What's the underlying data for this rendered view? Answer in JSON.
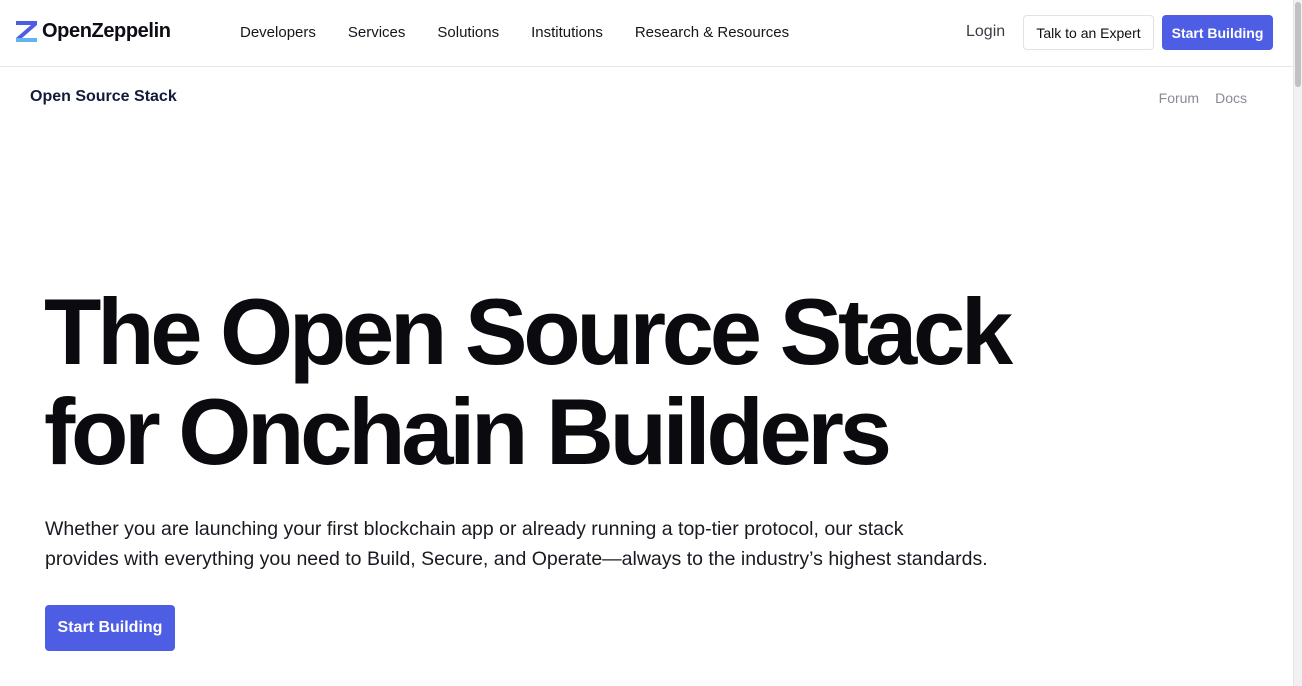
{
  "header": {
    "logo": {
      "icon": "openzeppelin-z-icon",
      "text": "OpenZeppelin",
      "color": "#4e5ee4"
    },
    "nav": [
      {
        "label": "Developers"
      },
      {
        "label": "Services"
      },
      {
        "label": "Solutions"
      },
      {
        "label": "Institutions"
      },
      {
        "label": "Research & Resources"
      }
    ],
    "login_label": "Login",
    "expert_label": "Talk to an Expert",
    "start_label": "Start Building"
  },
  "subnav": {
    "title": "Open Source Stack",
    "links": [
      {
        "label": "Forum"
      },
      {
        "label": "Docs"
      }
    ]
  },
  "hero": {
    "title_line1": "The Open Source Stack",
    "title_line2": "for Onchain Builders",
    "subtitle_line1": "Whether you are launching your first blockchain app or already running a top-tier protocol, our stack",
    "subtitle_line2": "provides with everything you need to Build, Secure, and Operate—always to the industry’s highest standards.",
    "cta_label": "Start Building"
  },
  "colors": {
    "accent": "#4e5ee4",
    "text": "#0d0d14",
    "muted": "#8a8a94"
  }
}
